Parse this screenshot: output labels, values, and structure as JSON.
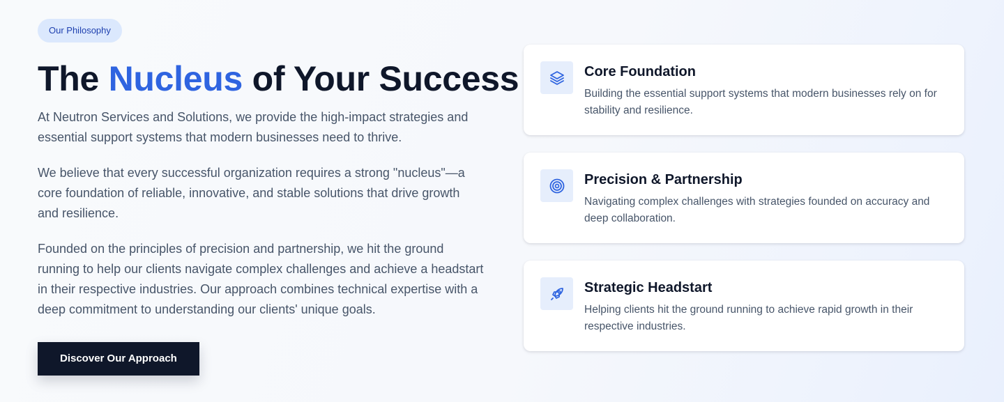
{
  "badge": "Our Philosophy",
  "headline": {
    "part1": "The ",
    "accent": "Nucleus",
    "part2": " of Your Success"
  },
  "paragraphs": [
    "At Neutron Services and Solutions, we provide the high-impact strategies and essential support systems that modern businesses need to thrive.",
    "We believe that every successful organization requires a strong \"nucleus\"—a core foundation of reliable, innovative, and stable solutions that drive growth and resilience.",
    "Founded on the principles of precision and partnership, we hit the ground running to help our clients navigate complex challenges and achieve a headstart in their respective industries. Our approach combines technical expertise with a deep commitment to understanding our clients' unique goals."
  ],
  "cta_label": "Discover Our Approach",
  "colors": {
    "accent": "#2f64e0",
    "dark": "#0f172a",
    "badge_bg": "#dbe8fd",
    "icon_bg": "#e6eefc"
  },
  "cards": [
    {
      "icon": "layers-icon",
      "title": "Core Foundation",
      "description": "Building the essential support systems that modern businesses rely on for stability and resilience."
    },
    {
      "icon": "target-icon",
      "title": "Precision & Partnership",
      "description": "Navigating complex challenges with strategies founded on accuracy and deep collaboration."
    },
    {
      "icon": "rocket-icon",
      "title": "Strategic Headstart",
      "description": "Helping clients hit the ground running to achieve rapid growth in their respective industries."
    }
  ]
}
